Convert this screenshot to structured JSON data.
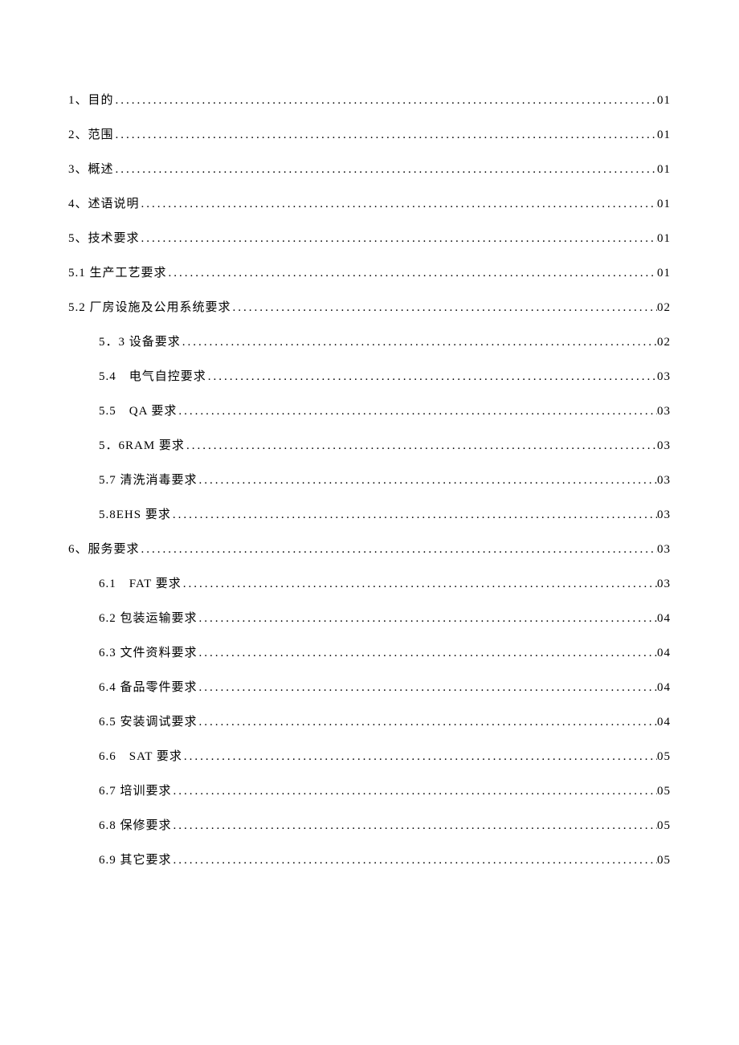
{
  "toc": {
    "entries": [
      {
        "label": "1、目的",
        "page": "01",
        "indent": 0
      },
      {
        "label": "2、范围",
        "page": "01",
        "indent": 0
      },
      {
        "label": "3、概述",
        "page": "01",
        "indent": 0
      },
      {
        "label": "4、述语说明",
        "page": "01",
        "indent": 0
      },
      {
        "label": "5、技术要求",
        "page": "01",
        "indent": 0
      },
      {
        "label": "5.1 生产工艺要求",
        "page": "01",
        "indent": 0
      },
      {
        "label": "5.2 厂房设施及公用系统要求",
        "page": "02",
        "indent": 0
      },
      {
        "label": "5．3 设备要求",
        "page": "02",
        "indent": 1
      },
      {
        "label": "5.4　电气自控要求",
        "page": "03",
        "indent": 1
      },
      {
        "label": "5.5　QA 要求",
        "page": "03",
        "indent": 1
      },
      {
        "label": "5．6RAM 要求",
        "page": "03",
        "indent": 1
      },
      {
        "label": "5.7 清洗消毒要求",
        "page": "03",
        "indent": 1
      },
      {
        "label": "5.8EHS 要求",
        "page": "03",
        "indent": 1
      },
      {
        "label": "6、服务要求",
        "page": "03",
        "indent": 0
      },
      {
        "label": "6.1　FAT 要求",
        "page": "03",
        "indent": 1
      },
      {
        "label": "6.2 包装运输要求",
        "page": "04",
        "indent": 1
      },
      {
        "label": "6.3 文件资料要求",
        "page": "04",
        "indent": 1
      },
      {
        "label": "6.4 备品零件要求",
        "page": "04",
        "indent": 1
      },
      {
        "label": "6.5 安装调试要求",
        "page": "04",
        "indent": 1
      },
      {
        "label": "6.6　SAT 要求",
        "page": "05",
        "indent": 1
      },
      {
        "label": "6.7 培训要求",
        "page": "05",
        "indent": 1
      },
      {
        "label": "6.8 保修要求",
        "page": "05",
        "indent": 1
      },
      {
        "label": "6.9 其它要求",
        "page": "05",
        "indent": 1
      }
    ]
  }
}
